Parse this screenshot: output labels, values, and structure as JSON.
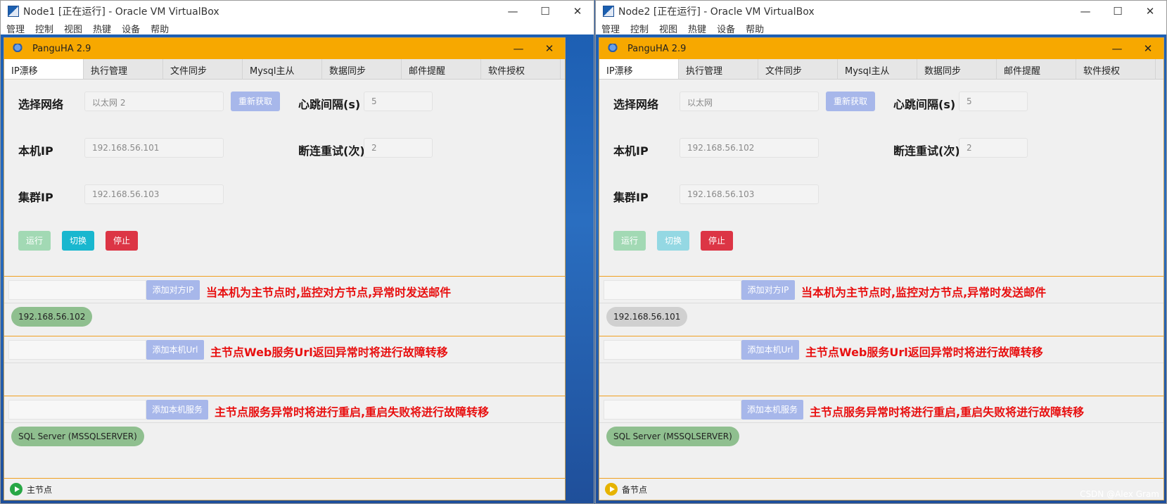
{
  "windows": [
    {
      "title": "Node1 [正在运行] - Oracle VM VirtualBox",
      "menu": [
        "管理",
        "控制",
        "视图",
        "热键",
        "设备",
        "帮助"
      ],
      "app_title": "PanguHA 2.9",
      "tabs": [
        "IP漂移",
        "执行管理",
        "文件同步",
        "Mysql主从",
        "数据同步",
        "邮件提醒",
        "软件授权"
      ],
      "labels": {
        "network": "选择网络",
        "local_ip": "本机IP",
        "cluster_ip": "集群IP",
        "heartbeat": "心跳间隔(s)",
        "retry": "断连重试(次)"
      },
      "values": {
        "network": "以太网 2",
        "local_ip": "192.168.56.101",
        "cluster_ip": "192.168.56.103",
        "heartbeat": "5",
        "retry": "2"
      },
      "buttons": {
        "refresh": "重新获取",
        "run": "运行",
        "switch": "切换",
        "stop": "停止",
        "add_peer": "添加对方IP",
        "add_url": "添加本机Url",
        "add_service": "添加本机服务"
      },
      "notes": {
        "peer": "当本机为主节点时,监控对方节点,异常时发送邮件",
        "url": "主节点Web服务Url返回异常时将进行故障转移",
        "service": "主节点服务异常时将进行重启,重启失败将进行故障转移"
      },
      "peer_ip": "192.168.56.102",
      "service": "SQL Server (MSSQLSERVER)",
      "status": "主节点"
    },
    {
      "title": "Node2 [正在运行] - Oracle VM VirtualBox",
      "menu": [
        "管理",
        "控制",
        "视图",
        "热键",
        "设备",
        "帮助"
      ],
      "app_title": "PanguHA 2.9",
      "tabs": [
        "IP漂移",
        "执行管理",
        "文件同步",
        "Mysql主从",
        "数据同步",
        "邮件提醒",
        "软件授权"
      ],
      "labels": {
        "network": "选择网络",
        "local_ip": "本机IP",
        "cluster_ip": "集群IP",
        "heartbeat": "心跳间隔(s)",
        "retry": "断连重试(次)"
      },
      "values": {
        "network": "以太网",
        "local_ip": "192.168.56.102",
        "cluster_ip": "192.168.56.103",
        "heartbeat": "5",
        "retry": "2"
      },
      "buttons": {
        "refresh": "重新获取",
        "run": "运行",
        "switch": "切换",
        "stop": "停止",
        "add_peer": "添加对方IP",
        "add_url": "添加本机Url",
        "add_service": "添加本机服务"
      },
      "notes": {
        "peer": "当本机为主节点时,监控对方节点,异常时发送邮件",
        "url": "主节点Web服务Url返回异常时将进行故障转移",
        "service": "主节点服务异常时将进行重启,重启失败将进行故障转移"
      },
      "peer_ip": "192.168.56.101",
      "service": "SQL Server (MSSQLSERVER)",
      "status": "备节点"
    }
  ],
  "watermark": "CSDN @Alex Gram",
  "icons": {
    "minimize": "minimize-icon",
    "maximize": "maximize-icon",
    "close": "close-icon",
    "status_primary": "play-green-icon",
    "status_backup": "play-yellow-icon"
  }
}
